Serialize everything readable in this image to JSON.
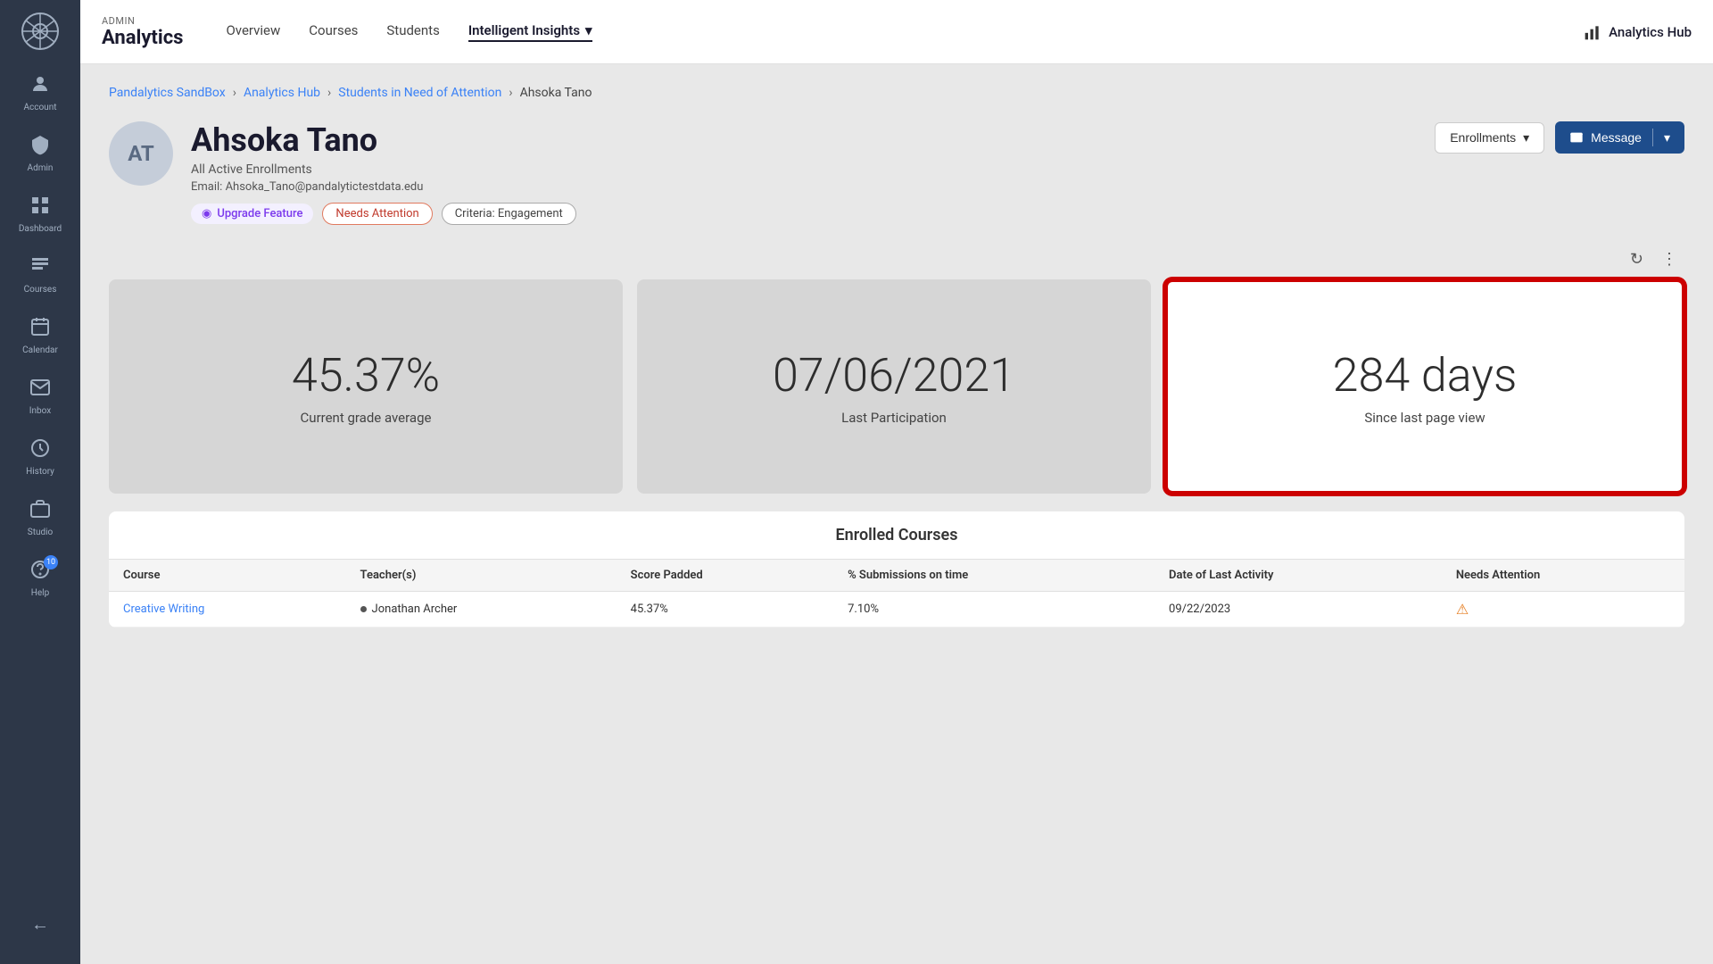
{
  "sidebar": {
    "logo_initials": "⚙",
    "items": [
      {
        "id": "account",
        "label": "Account",
        "icon": "👤",
        "active": false
      },
      {
        "id": "admin",
        "label": "Admin",
        "icon": "🛡",
        "active": false
      },
      {
        "id": "dashboard",
        "label": "Dashboard",
        "icon": "📊",
        "active": false
      },
      {
        "id": "courses",
        "label": "Courses",
        "icon": "📋",
        "active": false
      },
      {
        "id": "calendar",
        "label": "Calendar",
        "icon": "📅",
        "active": false
      },
      {
        "id": "inbox",
        "label": "Inbox",
        "icon": "✉",
        "active": false
      },
      {
        "id": "history",
        "label": "History",
        "icon": "🕐",
        "active": false
      },
      {
        "id": "studio",
        "label": "Studio",
        "icon": "📺",
        "active": false
      },
      {
        "id": "help",
        "label": "Help",
        "icon": "❓",
        "active": false,
        "badge": "10"
      }
    ],
    "back_label": "←"
  },
  "topnav": {
    "brand": {
      "admin_label": "ADMIN",
      "analytics_label": "Analytics"
    },
    "links": [
      {
        "id": "overview",
        "label": "Overview",
        "active": false
      },
      {
        "id": "courses",
        "label": "Courses",
        "active": false
      },
      {
        "id": "students",
        "label": "Students",
        "active": false
      },
      {
        "id": "intelligent-insights",
        "label": "Intelligent Insights",
        "active": true,
        "dropdown": true
      }
    ],
    "analytics_hub_label": "Analytics Hub"
  },
  "breadcrumb": {
    "items": [
      {
        "id": "pandalytics",
        "label": "Pandalytics SandBox",
        "link": true
      },
      {
        "id": "analytics-hub",
        "label": "Analytics Hub",
        "link": true
      },
      {
        "id": "students-need-attention",
        "label": "Students in Need of Attention",
        "link": true
      },
      {
        "id": "current",
        "label": "Ahsoka Tano",
        "link": false
      }
    ]
  },
  "student": {
    "initials": "AT",
    "name": "Ahsoka Tano",
    "subtitle": "All Active Enrollments",
    "email_label": "Email:",
    "email": "Ahsoka_Tano@pandalytictestdata.edu",
    "tags": {
      "upgrade": "Upgrade Feature",
      "needs_attention": "Needs Attention",
      "criteria": "Criteria: Engagement"
    },
    "actions": {
      "enrollments_label": "Enrollments",
      "message_label": "Message"
    }
  },
  "stats": [
    {
      "id": "grade-average",
      "value": "45.37%",
      "label": "Current grade average",
      "highlighted": false
    },
    {
      "id": "last-participation",
      "value": "07/06/2021",
      "label": "Last Participation",
      "highlighted": false
    },
    {
      "id": "since-last-view",
      "value": "284 days",
      "label": "Since last page view",
      "highlighted": true
    }
  ],
  "enrolled_courses": {
    "title": "Enrolled Courses",
    "columns": [
      "Course",
      "Teacher(s)",
      "Score Padded",
      "% Submissions on time",
      "Date of Last Activity",
      "Needs Attention"
    ],
    "rows": [
      {
        "course": "Creative Writing",
        "course_link": true,
        "teacher": "Jonathan Archer",
        "score_padded": "45.37%",
        "submissions_on_time": "7.10%",
        "last_activity": "09/22/2023",
        "needs_attention": true
      }
    ]
  },
  "icons": {
    "refresh": "↻",
    "more": "⋮",
    "dropdown_arrow": "▾",
    "mail": "✉",
    "bar_chart": "▮▮▮",
    "upgrade_dot": "◉",
    "chevron_right": "›"
  }
}
